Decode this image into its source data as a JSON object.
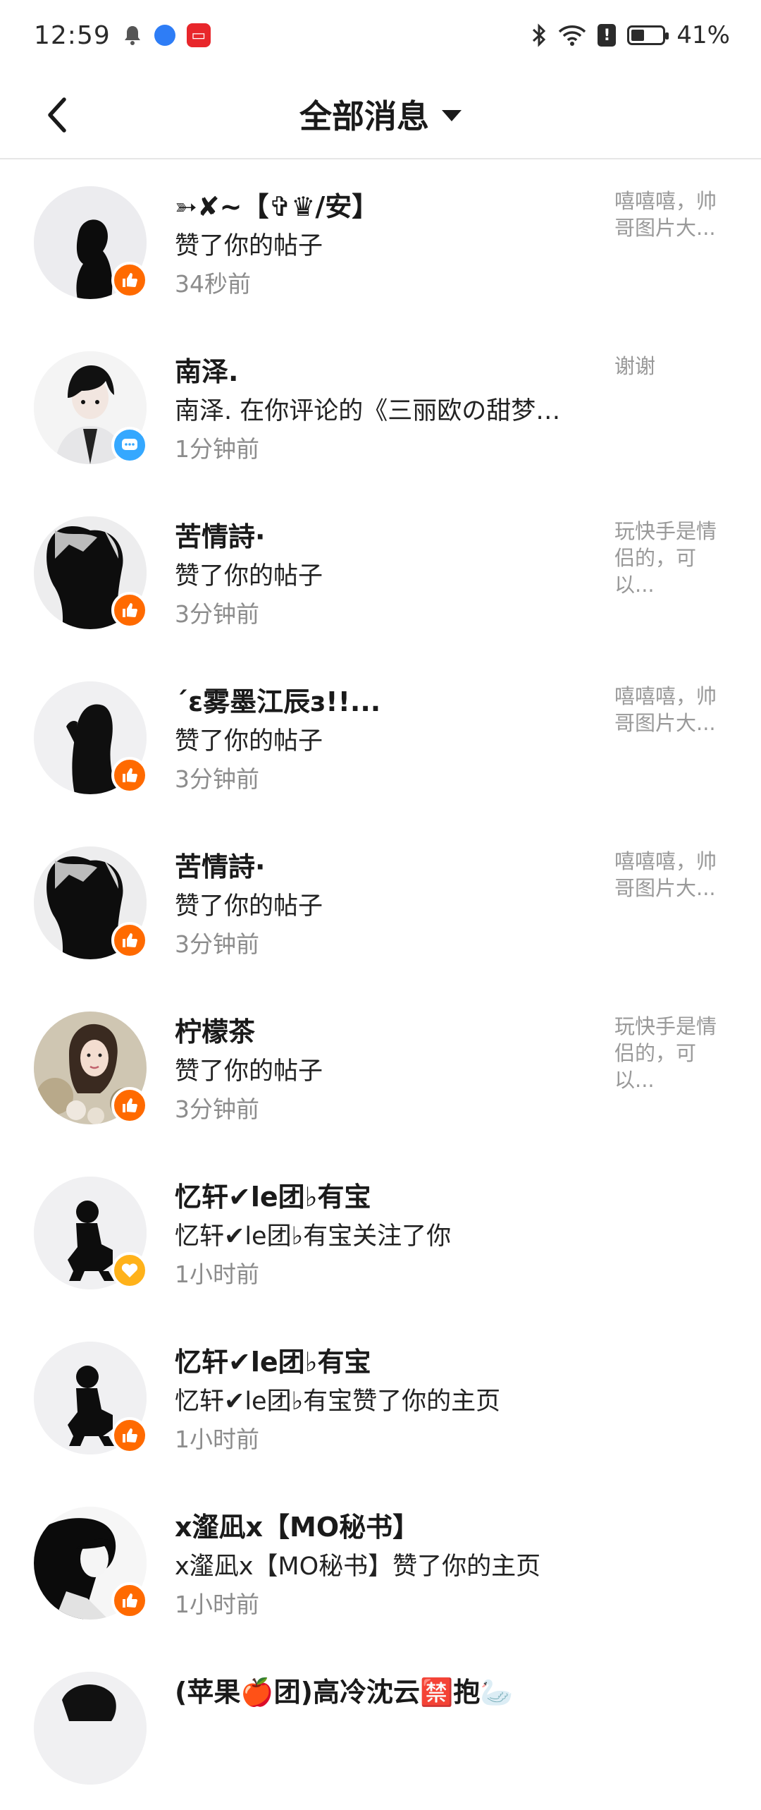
{
  "status_bar": {
    "time": "12:59",
    "battery_label": "41%",
    "battery_level": 0.41
  },
  "header": {
    "title": "全部消息"
  },
  "messages": [
    {
      "name": "➳✘~【✞♛/安】",
      "action": "赞了你的帖子",
      "time": "34秒前",
      "preview": " 嘻嘻嘻，帅哥图片大...",
      "badge": "like-icon"
    },
    {
      "name": "南泽.",
      "action": "南泽. 在你评论的《三丽欧の甜梦》...",
      "time": "1分钟前",
      "preview": "谢谢",
      "badge": "comment-icon"
    },
    {
      "name": "苦情詩·",
      "action": "赞了你的帖子",
      "time": "3分钟前",
      "preview": "玩快手是情侣的，可以...",
      "badge": "like-icon"
    },
    {
      "name": "´ε雾墨江辰з!!...",
      "action": "赞了你的帖子",
      "time": "3分钟前",
      "preview": " 嘻嘻嘻，帅哥图片大...",
      "badge": "like-icon"
    },
    {
      "name": "苦情詩·",
      "action": "赞了你的帖子",
      "time": "3分钟前",
      "preview": " 嘻嘻嘻，帅哥图片大...",
      "badge": "like-icon"
    },
    {
      "name": "柠檬茶",
      "action": "赞了你的帖子",
      "time": "3分钟前",
      "preview": "玩快手是情侣的，可以...",
      "badge": "like-icon"
    },
    {
      "name": "忆轩✔le团♭有宝",
      "action": "忆轩✔le团♭有宝关注了你",
      "time": "1小时前",
      "preview": "",
      "badge": "heart-icon"
    },
    {
      "name": "忆轩✔le团♭有宝",
      "action": "忆轩✔le团♭有宝赞了你的主页",
      "time": "1小时前",
      "preview": "",
      "badge": "like-icon"
    },
    {
      "name": "x瀣凪x【MO秘书】",
      "action": "x瀣凪x【MO秘书】赞了你的主页",
      "time": "1小时前",
      "preview": "",
      "badge": "like-icon"
    },
    {
      "name": "(苹果🍎团)高冷沈云🈲抱🦢",
      "action": "",
      "time": "",
      "preview": "",
      "badge": ""
    }
  ]
}
